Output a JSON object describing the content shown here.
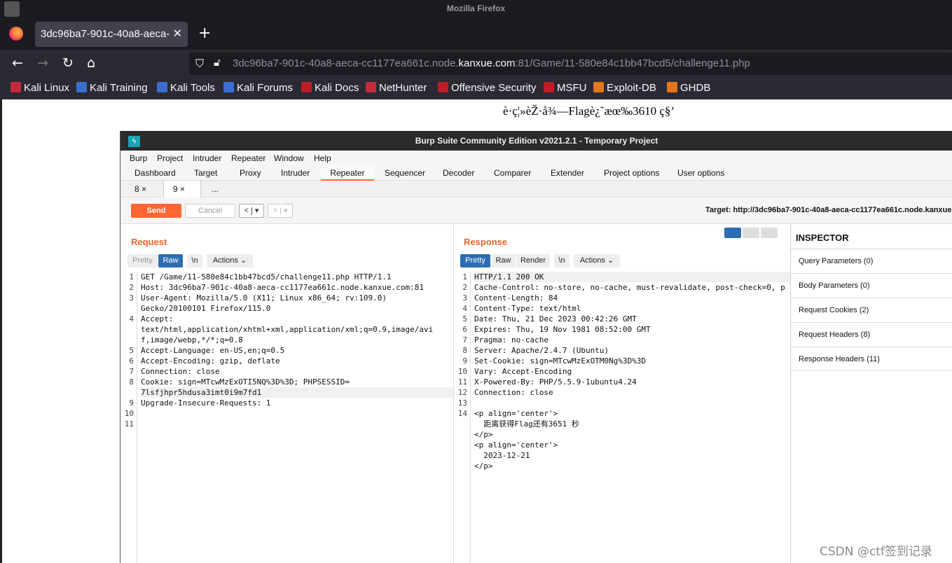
{
  "browser": {
    "window_title": "Mozilla Firefox",
    "tab_title": "3dc96ba7-901c-40a8-aeca-",
    "url_prefix": "3dc96ba7-901c-40a8-aeca-cc1177ea661c.node.",
    "url_domain": "kanxue.com",
    "url_suffix": ":81/Game/11-580e84c1bb47bcd5/challenge11.php",
    "bookmarks": [
      "Kali Linux",
      "Kali Training",
      "Kali Tools",
      "Kali Forums",
      "Kali Docs",
      "NetHunter",
      "Offensive Security",
      "MSFU",
      "Exploit-DB",
      "GHDB"
    ]
  },
  "page": {
    "garbled_text": "è·ç¦»èŽ·å¾—Flagè¿˜æœ‰3610 ç§’"
  },
  "burp": {
    "title": "Burp Suite Community Edition v2021.2.1 - Temporary Project",
    "menu": [
      "Burp",
      "Project",
      "Intruder",
      "Repeater",
      "Window",
      "Help"
    ],
    "tabs": [
      "Dashboard",
      "Target",
      "Proxy",
      "Intruder",
      "Repeater",
      "Sequencer",
      "Decoder",
      "Comparer",
      "Extender",
      "Project options",
      "User options"
    ],
    "active_tab": "Repeater",
    "repeater_tabs": [
      "8",
      "9",
      "..."
    ],
    "send_label": "Send",
    "cancel_label": "Cancel",
    "target_label": "Target: http://3dc96ba7-901c-40a8-aeca-cc1177ea661c.node.kanxue.c",
    "request": {
      "title": "Request",
      "buttons": [
        "Pretty",
        "Raw",
        "\\n",
        "Actions ⌄"
      ],
      "lines": [
        "GET /Game/11-580e84c1bb47bcd5/challenge11.php HTTP/1.1",
        "Host: 3dc96ba7-901c-40a8-aeca-cc1177ea661c.node.kanxue.com:81",
        "User-Agent: Mozilla/5.0 (X11; Linux x86_64; rv:109.0)",
        "Gecko/20100101 Firefox/115.0",
        "Accept:",
        "text/html,application/xhtml+xml,application/xml;q=0.9,image/avi",
        "f,image/webp,*/*;q=0.8",
        "Accept-Language: en-US,en;q=0.5",
        "Accept-Encoding: gzip, deflate",
        "Connection: close",
        "Cookie: sign=MTcwMzExOTI5NQ%3D%3D; PHPSESSID=",
        "7lsfjhpr5hdusa3imt0i9m7fd1",
        "Upgrade-Insecure-Requests: 1",
        "",
        ""
      ],
      "gutter": [
        "1",
        "2",
        "3",
        "",
        "4",
        "",
        "",
        "5",
        "6",
        "7",
        "8",
        "",
        "9",
        "10",
        "11"
      ]
    },
    "response": {
      "title": "Response",
      "buttons": [
        "Pretty",
        "Raw",
        "Render",
        "\\n",
        "Actions ⌄"
      ],
      "lines": [
        "HTTP/1.1 200 OK",
        "Cache-Control: no-store, no-cache, must-revalidate, post-check=0, p",
        "Content-Length: 84",
        "Content-Type: text/html",
        "Date: Thu, 21 Dec 2023 00:42:26 GMT",
        "Expires: Thu, 19 Nov 1981 08:52:00 GMT",
        "Pragma: no-cache",
        "Server: Apache/2.4.7 (Ubuntu)",
        "Set-Cookie: sign=MTcwMzExOTM0Ng%3D%3D",
        "Vary: Accept-Encoding",
        "X-Powered-By: PHP/5.5.9-1ubuntu4.24",
        "Connection: close",
        "",
        "<p align='center'>",
        "  距离获得Flag还有3651 秒",
        "</p>",
        "<p align='center'>",
        "  2023-12-21",
        "</p>"
      ],
      "gutter": [
        "1",
        "2",
        "3",
        "4",
        "5",
        "6",
        "7",
        "8",
        "9",
        "10",
        "11",
        "12",
        "13",
        "14",
        "",
        "",
        "",
        "",
        ""
      ]
    },
    "inspector": {
      "title": "INSPECTOR",
      "rows": [
        "Query Parameters (0)",
        "Body Parameters (0)",
        "Request Cookies (2)",
        "Request Headers (8)",
        "Response Headers (11)"
      ]
    }
  },
  "watermark": "CSDN @ctf签到记录"
}
